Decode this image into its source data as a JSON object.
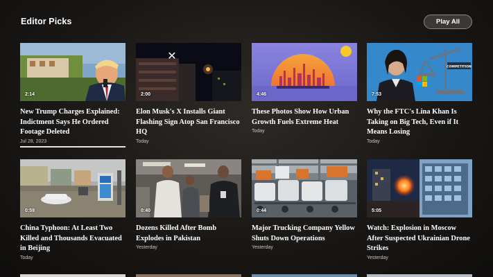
{
  "header": {
    "title": "Editor Picks",
    "play_all": "Play All"
  },
  "cards": [
    {
      "title": "New Trump Charges Explained: Indictment Says He Ordered Footage Deleted",
      "meta": "Jul 28, 2023",
      "duration": "2:14"
    },
    {
      "title": "Elon Musk's X Installs Giant Flashing Sign Atop San Francisco HQ",
      "meta": "Today",
      "duration": "2:00"
    },
    {
      "title": "These Photos Show How Urban Growth Fuels Extreme Heat",
      "meta": "Today",
      "duration": "4:46"
    },
    {
      "title": "Why the FTC's Lina Khan Is Taking on Big Tech, Even if It Means Losing",
      "meta": "Today",
      "duration": "7:53"
    },
    {
      "title": "China Typhoon: At Least Two Killed and Thousands Evacuated in Beijing",
      "meta": "Today",
      "duration": "0:59"
    },
    {
      "title": "Dozens Killed After Bomb Explodes in Pakistan",
      "meta": "Yesterday",
      "duration": "0:40"
    },
    {
      "title": "Major Trucking Company Yellow Shuts Down Operations",
      "meta": "Yesterday",
      "duration": "0:44"
    },
    {
      "title": "Watch: Explosion in Moscow After Suspected Ukrainian Drone Strikes",
      "meta": "Yesterday",
      "duration": "5:05"
    }
  ],
  "thumb_text": {
    "competition": "COMPETITION"
  }
}
